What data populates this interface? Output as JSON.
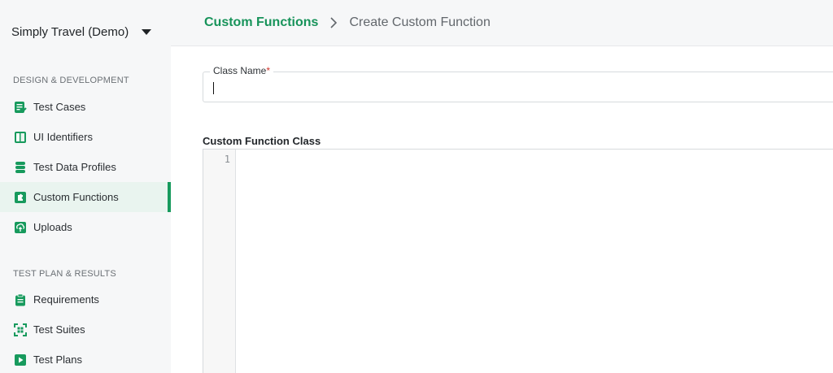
{
  "sidebar": {
    "workspace": "Simply Travel (Demo)",
    "sections": [
      {
        "title": "DESIGN & DEVELOPMENT",
        "items": [
          {
            "label": "Test Cases",
            "icon": "test-cases-icon"
          },
          {
            "label": "UI Identifiers",
            "icon": "ui-identifiers-icon"
          },
          {
            "label": "Test Data Profiles",
            "icon": "database-icon"
          },
          {
            "label": "Custom Functions",
            "icon": "puzzle-icon"
          },
          {
            "label": "Uploads",
            "icon": "upload-icon"
          }
        ]
      },
      {
        "title": "TEST PLAN & RESULTS",
        "items": [
          {
            "label": "Requirements",
            "icon": "clipboard-icon"
          },
          {
            "label": "Test Suites",
            "icon": "suites-icon"
          },
          {
            "label": "Test Plans",
            "icon": "play-icon"
          }
        ]
      }
    ],
    "active_item": "Custom Functions"
  },
  "breadcrumb": {
    "parent": "Custom Functions",
    "current": "Create Custom Function"
  },
  "form": {
    "class_name_label": "Class Name",
    "required_mark": "*",
    "class_name_value": "",
    "editor_label": "Custom Function Class",
    "line_numbers": [
      "1"
    ]
  },
  "colors": {
    "accent": "#179a5d",
    "sidebar_bg": "#f6f7f8",
    "active_bg": "#e9f4ef",
    "required": "#d0342c"
  }
}
